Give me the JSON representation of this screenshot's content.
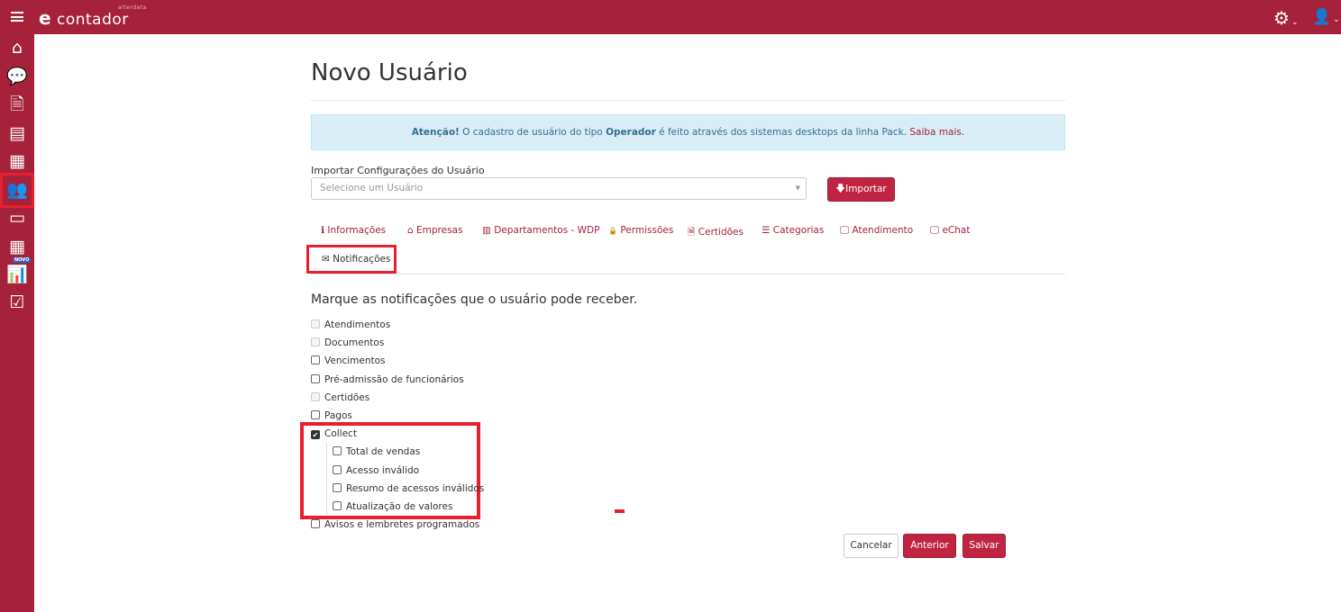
{
  "topbar": {
    "logo_main": "contador",
    "logo_e": "e",
    "logo_small": "alterdata",
    "settings_icon": "gear-icon",
    "user_icon": "user-icon"
  },
  "sidebar": {
    "items": [
      "home",
      "chat",
      "document",
      "contacts",
      "building",
      "users",
      "card",
      "calculator",
      "chart",
      "checklist"
    ],
    "novo_badge": "NOVO",
    "active": "users"
  },
  "page": {
    "title": "Novo Usuário"
  },
  "alert": {
    "strong": "Atenção!",
    "text1": " O cadastro de usuário do tipo ",
    "bold": "Operador",
    "text2": " é feito através dos sistemas desktops da linha Pack. ",
    "link": "Saiba mais."
  },
  "import": {
    "label": "Importar Configurações do Usuário",
    "placeholder": "Selecione um Usuário",
    "button": "Importar"
  },
  "tabs": [
    {
      "label": "Informações",
      "icon": "ℹ"
    },
    {
      "label": "Empresas",
      "icon": "⌂"
    },
    {
      "label": "Departamentos - WDP",
      "icon": "▥"
    },
    {
      "label": "Permissões",
      "icon": "🔒"
    },
    {
      "label": "Certidões",
      "icon": "🗎"
    },
    {
      "label": "Categorias",
      "icon": "☰"
    },
    {
      "label": "Atendimento",
      "icon": "🖵"
    },
    {
      "label": "eChat",
      "icon": "🖵"
    },
    {
      "label": "Notificações",
      "icon": "✉"
    }
  ],
  "active_tab": "Notificações",
  "notifications": {
    "heading": "Marque as notificações que o usuário pode receber.",
    "items": [
      {
        "label": "Atendimentos",
        "state": "disabled"
      },
      {
        "label": "Documentos",
        "state": "disabled"
      },
      {
        "label": "Vencimentos",
        "state": "unchecked"
      },
      {
        "label": "Pré-admissão de funcionários",
        "state": "unchecked"
      },
      {
        "label": "Certidões",
        "state": "disabled"
      },
      {
        "label": "Pagos",
        "state": "unchecked"
      },
      {
        "label": "Collect",
        "state": "checked"
      },
      {
        "label": "Total de vendas",
        "state": "unchecked"
      },
      {
        "label": "Acesso inválido",
        "state": "unchecked"
      },
      {
        "label": "Resumo de acessos inválidos",
        "state": "unchecked"
      },
      {
        "label": "Atualização de valores",
        "state": "unchecked"
      },
      {
        "label": "Avisos e lembretes programados",
        "state": "unchecked"
      }
    ]
  },
  "footer": {
    "cancel": "Cancelar",
    "previous": "Anterior",
    "save": "Salvar"
  }
}
